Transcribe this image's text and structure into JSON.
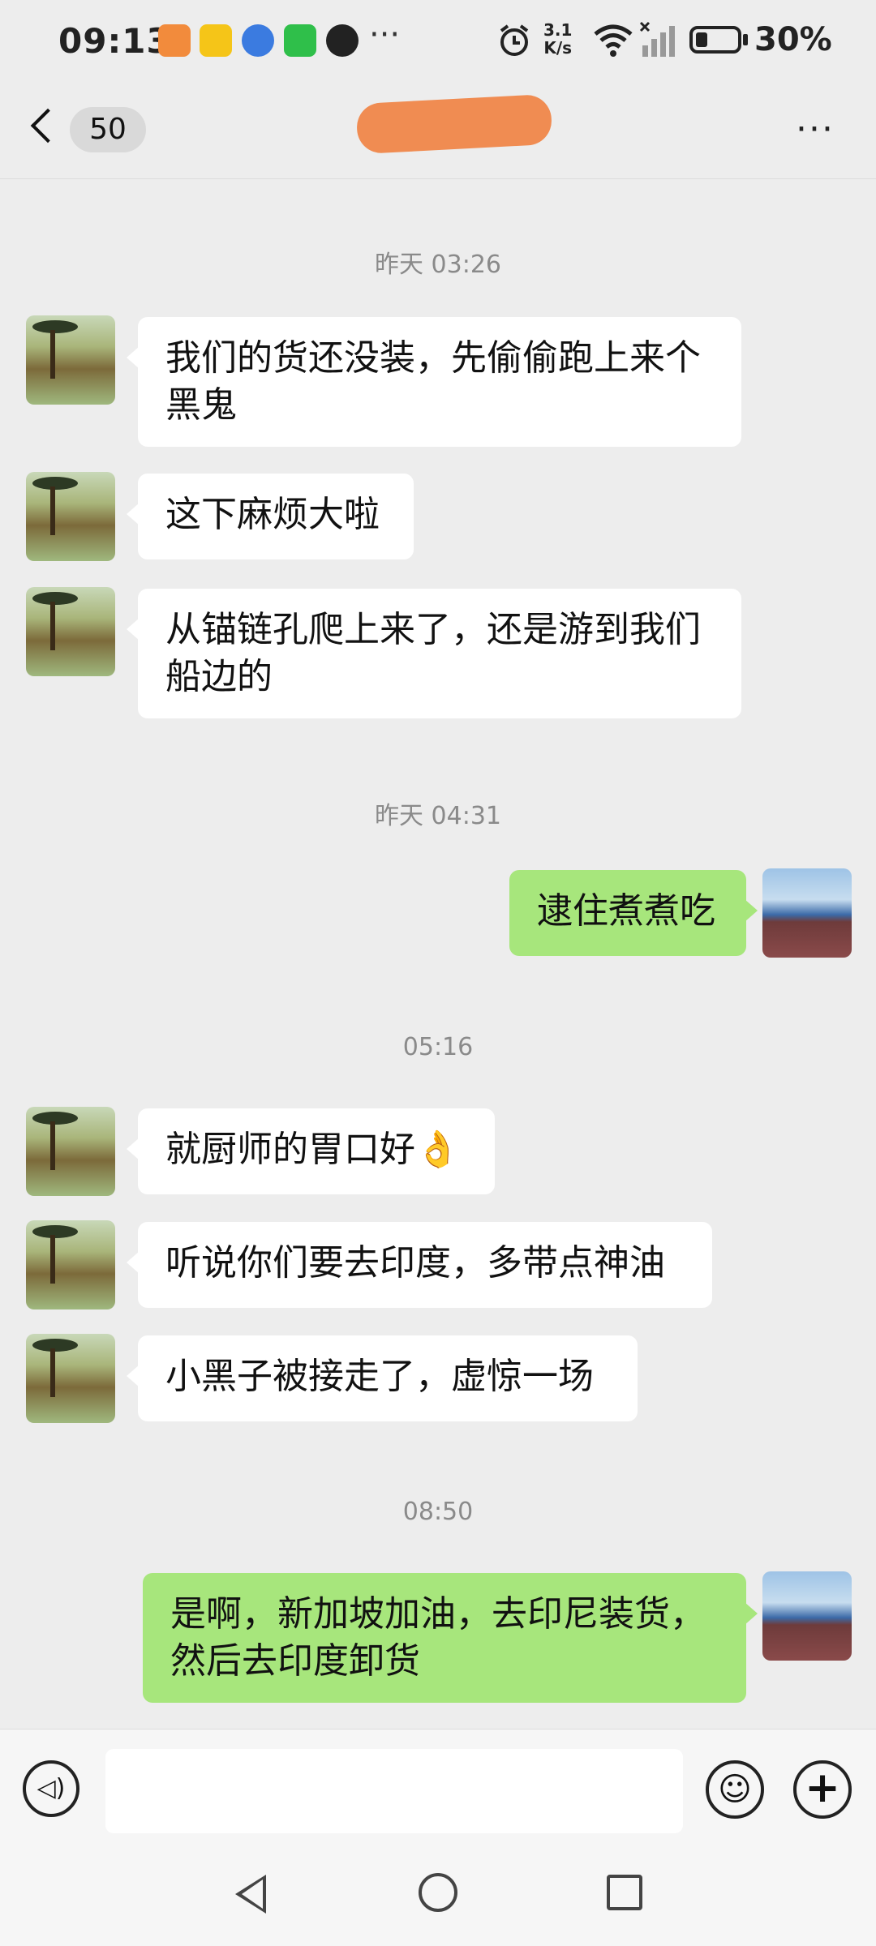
{
  "status_bar": {
    "time": "09:13",
    "apps": [
      "meituan-app-icon",
      "app-icon",
      "iqiyi-app-icon",
      "qq-app-icon"
    ],
    "more": "···",
    "net_speed_value": "3.1",
    "net_speed_unit": "K/s",
    "battery_percent_text": "30%",
    "battery_level": 0.3
  },
  "header": {
    "unread_count": "50",
    "more": "···"
  },
  "messages": [
    {
      "type": "time",
      "text": "昨天 03:26"
    },
    {
      "type": "msg",
      "side": "left",
      "lines": [
        "我们的货还没装，先偷偷跑上来个",
        "黑鬼"
      ]
    },
    {
      "type": "msg",
      "side": "left",
      "lines": [
        "这下麻烦大啦"
      ]
    },
    {
      "type": "msg",
      "side": "left",
      "lines": [
        "从锚链孔爬上来了，还是游到我们",
        "船边的"
      ]
    },
    {
      "type": "time",
      "text": "昨天 04:31"
    },
    {
      "type": "msg",
      "side": "right",
      "lines": [
        "逮住煮煮吃"
      ]
    },
    {
      "type": "time",
      "text": "05:16"
    },
    {
      "type": "msg",
      "side": "left",
      "lines": [
        "就厨师的胃口好👌"
      ]
    },
    {
      "type": "msg",
      "side": "left",
      "lines": [
        "听说你们要去印度，多带点神油"
      ]
    },
    {
      "type": "msg",
      "side": "left",
      "lines": [
        "小黑子被接走了，虚惊一场"
      ]
    },
    {
      "type": "time",
      "text": "08:50"
    },
    {
      "type": "msg",
      "side": "right",
      "lines": [
        "是啊，新加坡加油，去印尼装货，",
        "然后去印度卸货"
      ]
    }
  ],
  "input_bar": {
    "text_value": "",
    "voice_icon": "voice-icon",
    "emoji_icon": "emoji-icon",
    "plus_icon": "plus-icon"
  },
  "colors": {
    "background": "#ededed",
    "bubble_left": "#ffffff",
    "bubble_right": "#a7e67c",
    "timestamp": "#8a8a8a"
  }
}
